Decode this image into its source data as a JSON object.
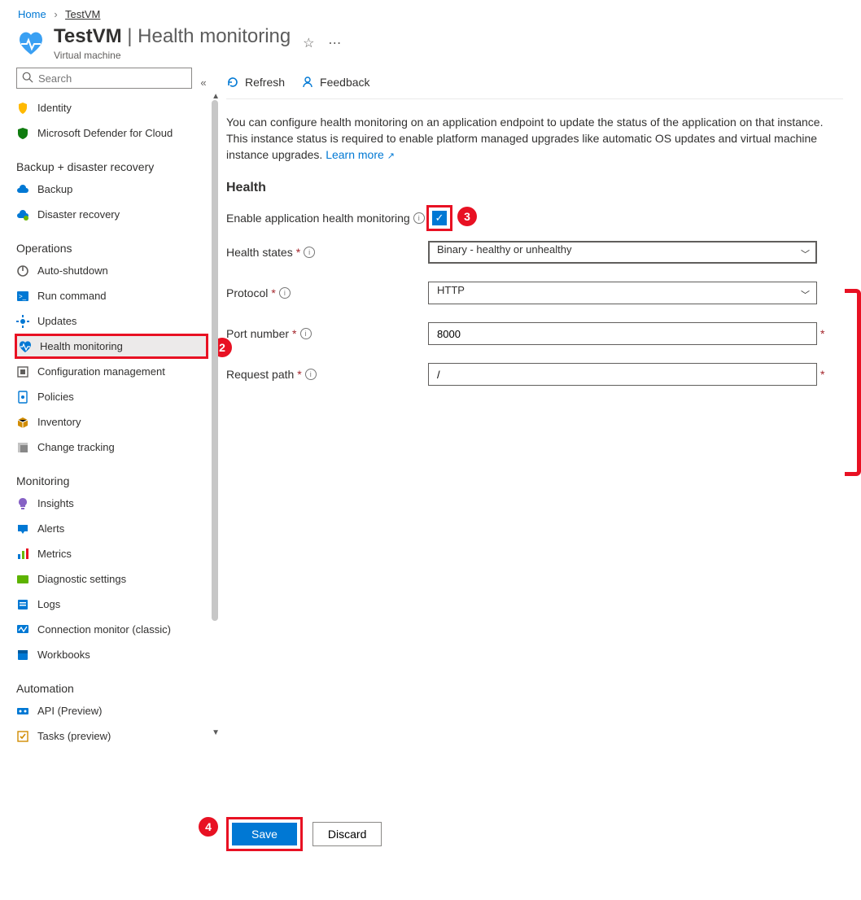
{
  "breadcrumb": {
    "home": "Home",
    "current": "TestVM"
  },
  "header": {
    "resource": "TestVM",
    "separator": " | ",
    "page": "Health monitoring",
    "subtype": "Virtual machine"
  },
  "search": {
    "placeholder": "Search"
  },
  "sidebar": {
    "top_items": [
      {
        "label": "Identity",
        "icon": "identity",
        "color": "#ffb900"
      },
      {
        "label": "Microsoft Defender for Cloud",
        "icon": "shield",
        "color": "#107c10"
      }
    ],
    "groups": [
      {
        "title": "Backup + disaster recovery",
        "items": [
          {
            "label": "Backup",
            "icon": "backup",
            "color": "#0078d4"
          },
          {
            "label": "Disaster recovery",
            "icon": "dr",
            "color": "#0078d4"
          }
        ]
      },
      {
        "title": "Operations",
        "items": [
          {
            "label": "Auto-shutdown",
            "icon": "power",
            "color": "#605e5c"
          },
          {
            "label": "Run command",
            "icon": "terminal",
            "color": "#0078d4"
          },
          {
            "label": "Updates",
            "icon": "gear",
            "color": "#0078d4"
          },
          {
            "label": "Health monitoring",
            "icon": "heart",
            "color": "#0078d4",
            "selected": true,
            "highlight_box": true
          },
          {
            "label": "Configuration management",
            "icon": "config",
            "color": "#605e5c"
          },
          {
            "label": "Policies",
            "icon": "policy",
            "color": "#0078d4"
          },
          {
            "label": "Inventory",
            "icon": "box",
            "color": "#d18c00"
          },
          {
            "label": "Change tracking",
            "icon": "changes",
            "color": "#888"
          }
        ]
      },
      {
        "title": "Monitoring",
        "items": [
          {
            "label": "Insights",
            "icon": "bulb",
            "color": "#8661c5"
          },
          {
            "label": "Alerts",
            "icon": "alert",
            "color": "#0078d4"
          },
          {
            "label": "Metrics",
            "icon": "bars",
            "color": "#0078d4"
          },
          {
            "label": "Diagnostic settings",
            "icon": "diag",
            "color": "#5db300"
          },
          {
            "label": "Logs",
            "icon": "logs",
            "color": "#0078d4"
          },
          {
            "label": "Connection monitor (classic)",
            "icon": "connmon",
            "color": "#0078d4"
          },
          {
            "label": "Workbooks",
            "icon": "workbook",
            "color": "#0078d4"
          }
        ]
      },
      {
        "title": "Automation",
        "items": [
          {
            "label": "API (Preview)",
            "icon": "api",
            "color": "#0078d4"
          },
          {
            "label": "Tasks (preview)",
            "icon": "tasks",
            "color": "#d18c00"
          }
        ]
      }
    ]
  },
  "callouts": {
    "c2": "2",
    "c3": "3",
    "c4": "4"
  },
  "commands": {
    "refresh": "Refresh",
    "feedback": "Feedback"
  },
  "intro": {
    "text": "You can configure health monitoring on an application endpoint to update the status of the application on that instance. This instance status is required to enable platform managed upgrades like automatic OS updates and virtual machine instance upgrades. ",
    "link": "Learn more"
  },
  "section": {
    "title": "Health"
  },
  "fields": {
    "enable": {
      "label": "Enable application health monitoring",
      "checked": true
    },
    "health_states": {
      "label": "Health states",
      "value": "Binary - healthy or unhealthy"
    },
    "protocol": {
      "label": "Protocol",
      "value": "HTTP"
    },
    "port": {
      "label": "Port number",
      "value": "8000"
    },
    "path": {
      "label": "Request path",
      "value": "/"
    }
  },
  "buttons": {
    "save": "Save",
    "discard": "Discard"
  }
}
